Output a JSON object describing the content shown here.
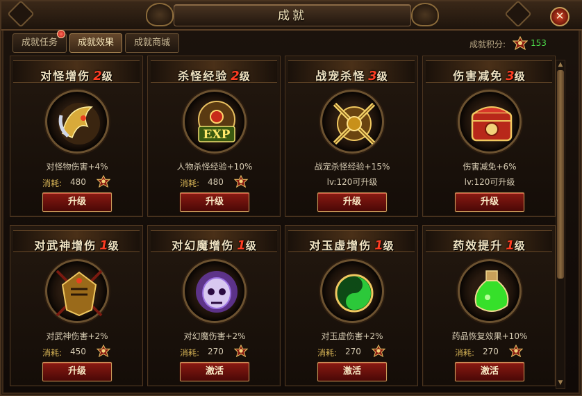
{
  "window": {
    "title": "成就"
  },
  "tabs": [
    {
      "label": "成就任务",
      "active": false,
      "has_notification": true
    },
    {
      "label": "成就效果",
      "active": true,
      "has_notification": false
    },
    {
      "label": "成就商城",
      "active": false,
      "has_notification": false
    }
  ],
  "score": {
    "label": "成就积分:",
    "value": "153",
    "icon": "achievement-emblem-icon"
  },
  "cost_label": "消耗:",
  "colors": {
    "level_number": "#ff3d22",
    "cost_label": "#d9b657",
    "score_value": "#4bdb4a",
    "button": "#8a1a12"
  },
  "cards": [
    {
      "name": "对怪增伤",
      "level": "2",
      "level_suffix": "级",
      "icon": "golden-dragon-axe-icon",
      "effect": "对怪物伤害+4%",
      "cost": "480",
      "status": "",
      "button": "升级"
    },
    {
      "name": "杀怪经验",
      "level": "2",
      "level_suffix": "级",
      "icon": "exp-crest-icon",
      "effect": "人物杀怪经验+10%",
      "cost": "480",
      "status": "",
      "button": "升级"
    },
    {
      "name": "战宠杀怪",
      "level": "3",
      "level_suffix": "级",
      "icon": "crossed-swords-crest-icon",
      "effect": "战宠杀怪经验+15%",
      "cost": "",
      "status": "lv:120可升级",
      "button": "升级"
    },
    {
      "name": "伤害减免",
      "level": "3",
      "level_suffix": "级",
      "icon": "treasure-chest-icon",
      "effect": "伤害减免+6%",
      "cost": "",
      "status": "lv:120可升级",
      "button": "升级"
    },
    {
      "name": "对武神增伤",
      "level": "1",
      "level_suffix": "级",
      "icon": "warrior-helmet-crest-icon",
      "effect": "对武神伤害+2%",
      "cost": "450",
      "status": "",
      "button": "升级"
    },
    {
      "name": "对幻魔增伤",
      "level": "1",
      "level_suffix": "级",
      "icon": "purple-skull-icon",
      "effect": "对幻魔伤害+2%",
      "cost": "270",
      "status": "",
      "button": "激活"
    },
    {
      "name": "对玉虚增伤",
      "level": "1",
      "level_suffix": "级",
      "icon": "yin-yang-crest-icon",
      "effect": "对玉虚伤害+2%",
      "cost": "270",
      "status": "",
      "button": "激活"
    },
    {
      "name": "药效提升",
      "level": "1",
      "level_suffix": "级",
      "icon": "green-potion-icon",
      "effect": "药品恢复效果+10%",
      "cost": "270",
      "status": "",
      "button": "激活"
    }
  ]
}
